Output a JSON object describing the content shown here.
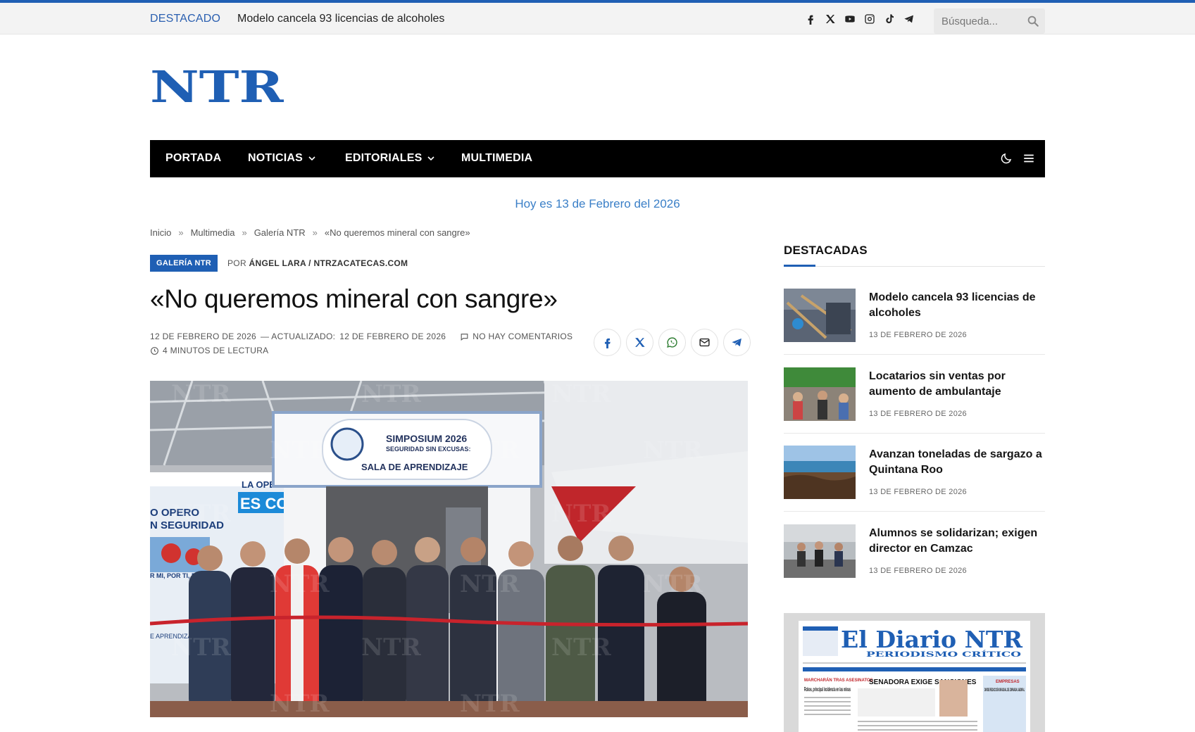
{
  "topbar": {
    "featured_label": "DESTACADO",
    "ticker_text": "Modelo cancela 93 licencias de alcoholes",
    "social_icons": [
      "facebook-icon",
      "x-icon",
      "youtube-icon",
      "instagram-icon",
      "tiktok-icon",
      "telegram-icon"
    ],
    "search_placeholder": "Búsqueda..."
  },
  "logo": {
    "text": "NTR",
    "color": "#1f5fb4"
  },
  "nav": {
    "items": [
      {
        "label": "PORTADA",
        "has_dropdown": false
      },
      {
        "label": "NOTICIAS",
        "has_dropdown": true
      },
      {
        "label": "EDITORIALES",
        "has_dropdown": true
      },
      {
        "label": "MULTIMEDIA",
        "has_dropdown": false
      }
    ]
  },
  "today_text": "Hoy es 13 de Febrero del 2026",
  "breadcrumb": {
    "items": [
      "Inicio",
      "Multimedia",
      "Galería NTR",
      "«No queremos mineral con sangre»"
    ],
    "separator": "»"
  },
  "article": {
    "category": "GALERÍA NTR",
    "byline_prefix": "POR",
    "author": "ÁNGEL LARA / NTRZACATECAS.COM",
    "title": "«No queremos mineral con sangre»",
    "published": "12 DE FEBRERO DE 2026",
    "updated_label": "— ACTUALIZADO:",
    "updated": "12 DE FEBRERO DE 2026",
    "comments": "NO HAY COMENTARIOS",
    "reading_time": "4 MINUTOS DE LECTURA",
    "share_icons": [
      "facebook-icon",
      "x-icon",
      "whatsapp-icon",
      "email-icon",
      "telegram-icon"
    ]
  },
  "hero_image": {
    "sign_title": "SIMPOSIUM 2026",
    "sign_subtitle": "SEGURIDAD SIN EXCUSAS:",
    "sign_room": "SALA DE APRENDIZAJE",
    "banner_line1": "LA OPERAC",
    "banner_line2": "ES COM",
    "banner_line3": "O OPERO",
    "banner_line4": "N SEGURIDAD",
    "banner_line5": "R MI, POR TI, POR TOD",
    "banner_line6": "E APRENDIZAJE",
    "watermark": "NTR"
  },
  "sidebar": {
    "title": "DESTACADAS",
    "posts": [
      {
        "title": "Modelo cancela 93 licencias de alcoholes",
        "date": "13 DE FEBRERO DE 2026"
      },
      {
        "title": "Locatarios sin ventas por aumento de ambulantaje",
        "date": "13 DE FEBRERO DE 2026"
      },
      {
        "title": "Avanzan toneladas de sargazo a Quintana Roo",
        "date": "13 DE FEBRERO DE 2026"
      },
      {
        "title": "Alumnos se solidarizan; exigen director en Camzac",
        "date": "13 DE FEBRERO DE 2026"
      }
    ]
  },
  "newspaper": {
    "masthead": "El Diario NTR",
    "tagline": "PERIODISMO CRÍTICO",
    "headline_main": "SENADORA EXIGE SANCIONES",
    "headline_left_kicker": "MARCHARÁN TRAS ASESINATOS",
    "headline_left": "Robos, principal incidencia en las minas",
    "headline_right_kicker": "EMPRESAS",
    "headline_right": "DIVIDE REDUCCIÓN GRADUAL DE JORNADA LABORAL"
  },
  "colors": {
    "accent": "#1f5fb4",
    "nav_bg": "#000000",
    "today": "#3a7fc7"
  }
}
